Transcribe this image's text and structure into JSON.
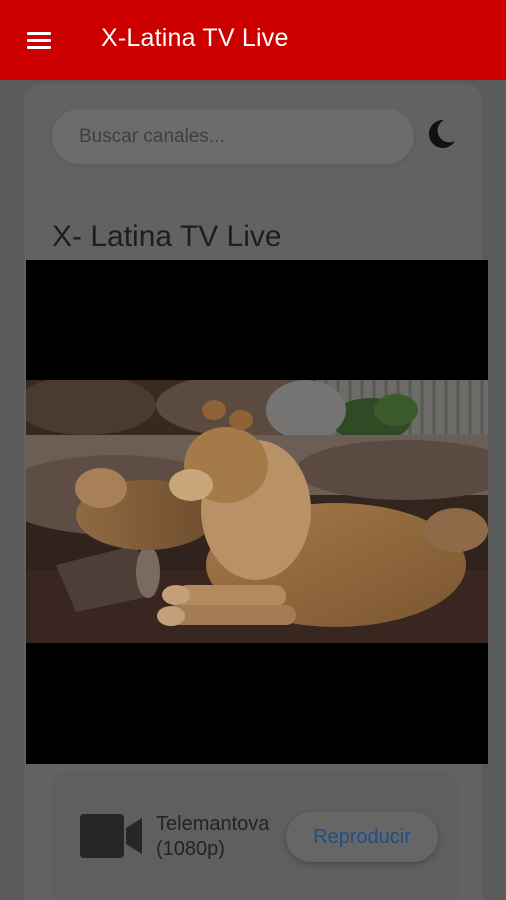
{
  "appbar": {
    "title": "X-Latina TV Live",
    "menu_icon": "hamburger-menu-icon",
    "color": "#cc0000"
  },
  "search": {
    "placeholder": "Buscar canales...",
    "value": ""
  },
  "theme_toggle": {
    "icon": "moon-icon"
  },
  "player": {
    "section_title": "X- Latina TV Live",
    "thumbnail": "lions-resting-image"
  },
  "channels": [
    {
      "icon": "video-camera-icon",
      "name": "Telemantova (1080p)",
      "action_label": "Reproducir"
    }
  ]
}
